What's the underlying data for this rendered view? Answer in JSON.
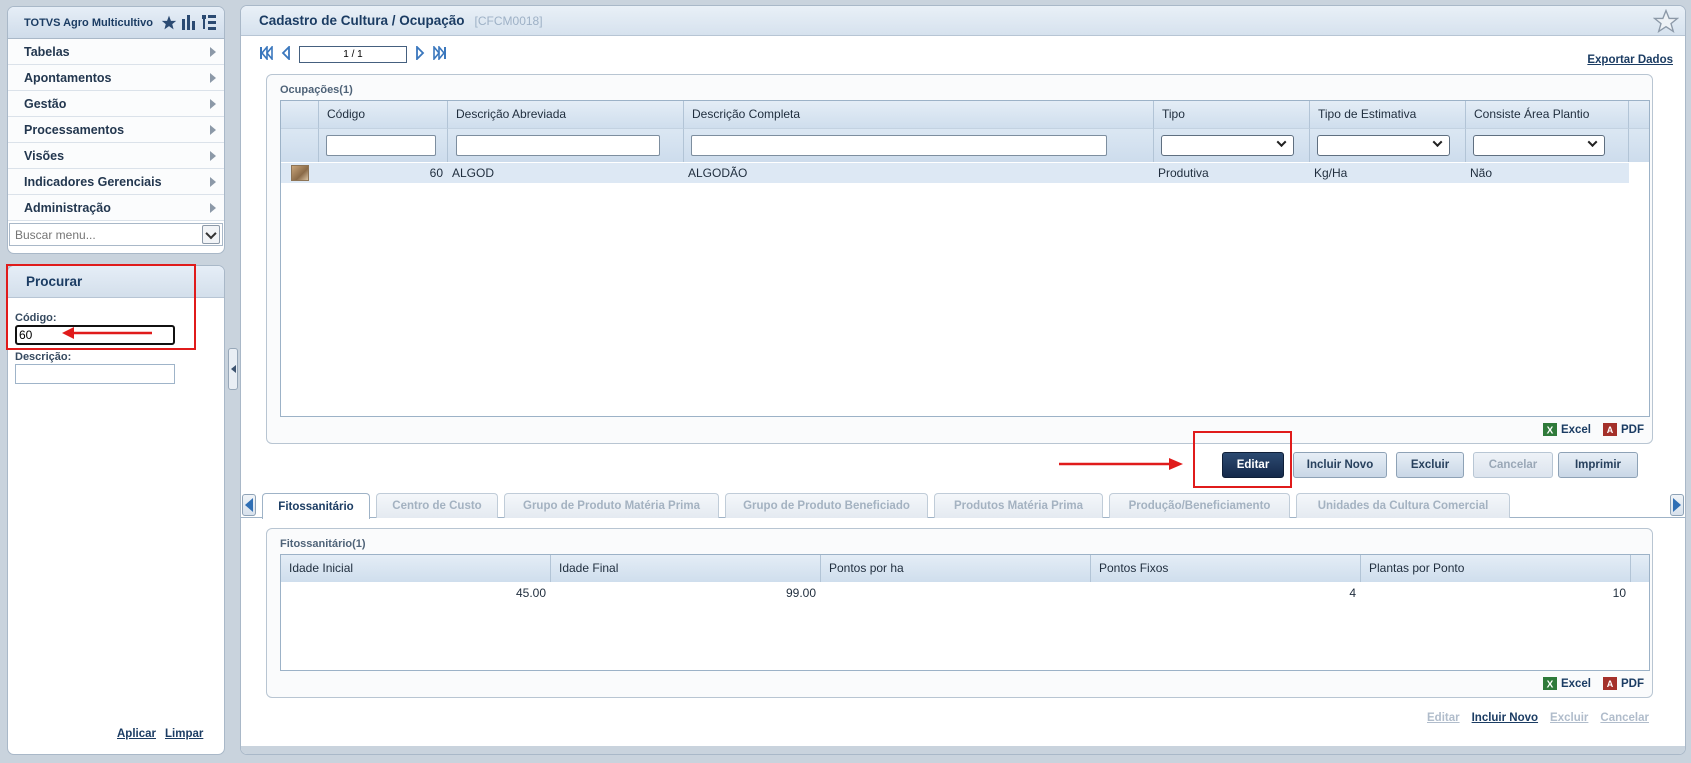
{
  "app": {
    "title": "TOTVS Agro Multicultivo",
    "icons": [
      "star-icon",
      "bar-chart-icon",
      "tree-list-icon"
    ]
  },
  "menu": {
    "items": [
      {
        "label": "Tabelas"
      },
      {
        "label": "Apontamentos"
      },
      {
        "label": "Gestão"
      },
      {
        "label": "Processamentos"
      },
      {
        "label": "Visões"
      },
      {
        "label": "Indicadores Gerenciais"
      },
      {
        "label": "Administração"
      }
    ],
    "search_placeholder": "Buscar menu..."
  },
  "search_panel": {
    "title": "Procurar",
    "codigo_label": "Código:",
    "codigo_value": "60",
    "descricao_label": "Descrição:",
    "descricao_value": "",
    "apply_label": "Aplicar",
    "clear_label": "Limpar"
  },
  "page": {
    "title": "Cadastro de Cultura / Ocupação",
    "code": "[CFCM0018]",
    "pager": "1 / 1",
    "export_label": "Exportar Dados"
  },
  "ocupacoes": {
    "caption": "Ocupações(1)",
    "columns": [
      "Código",
      "Descrição Abreviada",
      "Descrição Completa",
      "Tipo",
      "Tipo de Estimativa",
      "Consiste Área Plantio"
    ],
    "rows": [
      {
        "codigo": "60",
        "abreviada": "ALGOD",
        "completa": "ALGODÃO",
        "tipo": "Produtiva",
        "estimativa": "Kg/Ha",
        "consiste": "Não"
      }
    ],
    "excel_label": "Excel",
    "pdf_label": "PDF"
  },
  "actions": {
    "editar": "Editar",
    "incluir": "Incluir Novo",
    "excluir": "Excluir",
    "cancelar": "Cancelar",
    "imprimir": "Imprimir"
  },
  "tabs": [
    {
      "label": "Fitossanitário"
    },
    {
      "label": "Centro de Custo"
    },
    {
      "label": "Grupo de Produto Matéria Prima"
    },
    {
      "label": "Grupo de Produto Beneficiado"
    },
    {
      "label": "Produtos Matéria Prima"
    },
    {
      "label": "Produção/Beneficiamento"
    },
    {
      "label": "Unidades da Cultura Comercial"
    }
  ],
  "fito": {
    "caption": "Fitossanitário(1)",
    "columns": [
      "Idade Inicial",
      "Idade Final",
      "Pontos por ha",
      "Pontos Fixos",
      "Plantas por Ponto"
    ],
    "rows": [
      {
        "idade_inicial": "45.00",
        "idade_final": "99.00",
        "pontos_ha": "",
        "pontos_fixos": "4",
        "plantas_ponto": "10"
      }
    ],
    "excel_label": "Excel",
    "pdf_label": "PDF"
  },
  "bottom_actions": {
    "editar": "Editar",
    "incluir": "Incluir Novo",
    "excluir": "Excluir",
    "cancelar": "Cancelar"
  },
  "colors": {
    "accent": "#1b3c63",
    "annotation": "#e01b1b",
    "primary_button": "#1d3559"
  }
}
